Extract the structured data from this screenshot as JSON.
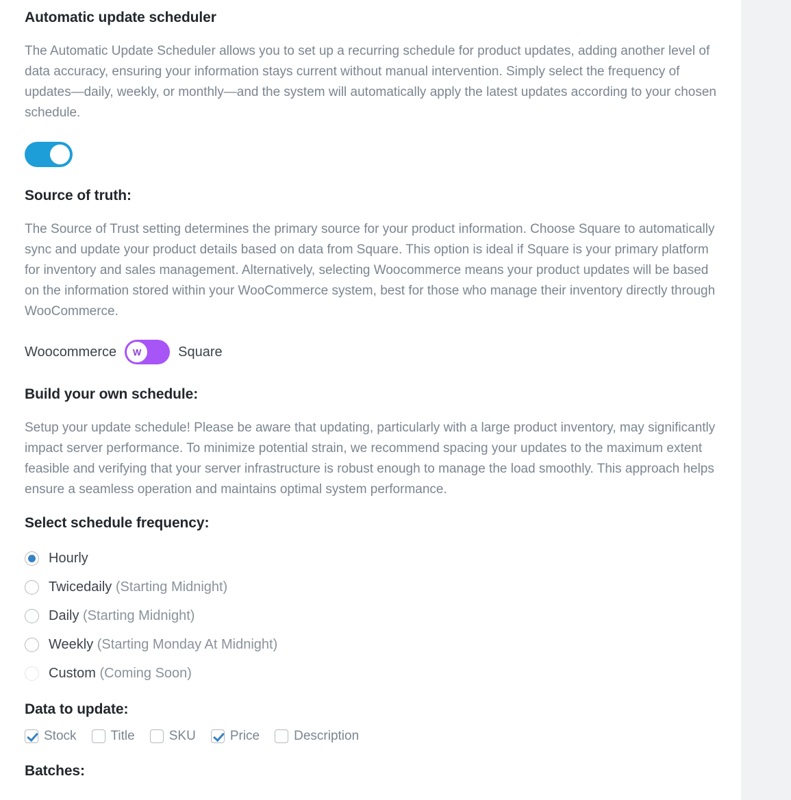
{
  "automatic_update_scheduler": {
    "title": "Automatic update scheduler",
    "description": "The Automatic Update Scheduler allows you to set up a recurring schedule for product updates, adding another level of data accuracy, ensuring your information stays current without manual intervention. Simply select the frequency of updates—daily, weekly, or monthly—and the system will automatically apply the latest updates according to your chosen schedule.",
    "enabled": true
  },
  "source_of_truth": {
    "title": "Source of truth:",
    "description": "The Source of Trust setting determines the primary source for your product information. Choose Square to automatically sync and update your product details based on data from Square. This option is ideal if Square is your primary platform for inventory and sales management. Alternatively, selecting Woocommerce means your product updates will be based on the information stored within your WooCommerce system, best for those who manage their inventory directly through WooCommerce.",
    "left_label": "Woocommerce",
    "right_label": "Square",
    "knob_glyph": "W",
    "selected": "Woocommerce",
    "track_color": "#a855f7"
  },
  "build_schedule": {
    "title": "Build your own schedule:",
    "description": "Setup your update schedule! Please be aware that updating, particularly with a large product inventory, may significantly impact server performance. To minimize potential strain, we recommend spacing your updates to the maximum extent feasible and verifying that your server infrastructure is robust enough to manage the load smoothly. This approach helps ensure a seamless operation and maintains optimal system performance."
  },
  "schedule_frequency": {
    "title": "Select schedule frequency:",
    "options": [
      {
        "label": "Hourly",
        "note": "",
        "checked": true,
        "disabled": false
      },
      {
        "label": "Twicedaily",
        "note": "(Starting Midnight)",
        "checked": false,
        "disabled": false
      },
      {
        "label": "Daily",
        "note": "(Starting Midnight)",
        "checked": false,
        "disabled": false
      },
      {
        "label": "Weekly",
        "note": "(Starting Monday At Midnight)",
        "checked": false,
        "disabled": false
      },
      {
        "label": "Custom",
        "note": "(Coming Soon)",
        "checked": false,
        "disabled": true
      }
    ]
  },
  "data_to_update": {
    "title": "Data to update:",
    "options": [
      {
        "label": "Stock",
        "checked": true
      },
      {
        "label": "Title",
        "checked": false
      },
      {
        "label": "SKU",
        "checked": false
      },
      {
        "label": "Price",
        "checked": true
      },
      {
        "label": "Description",
        "checked": false
      }
    ]
  },
  "batches": {
    "title": "Batches:"
  },
  "colors": {
    "accent_blue": "#3582c4",
    "toggle_blue": "#1e9ed8",
    "purple": "#a855f7",
    "heading": "#22272c",
    "body_text": "#7b8590",
    "gutter": "#f1f2f4"
  }
}
